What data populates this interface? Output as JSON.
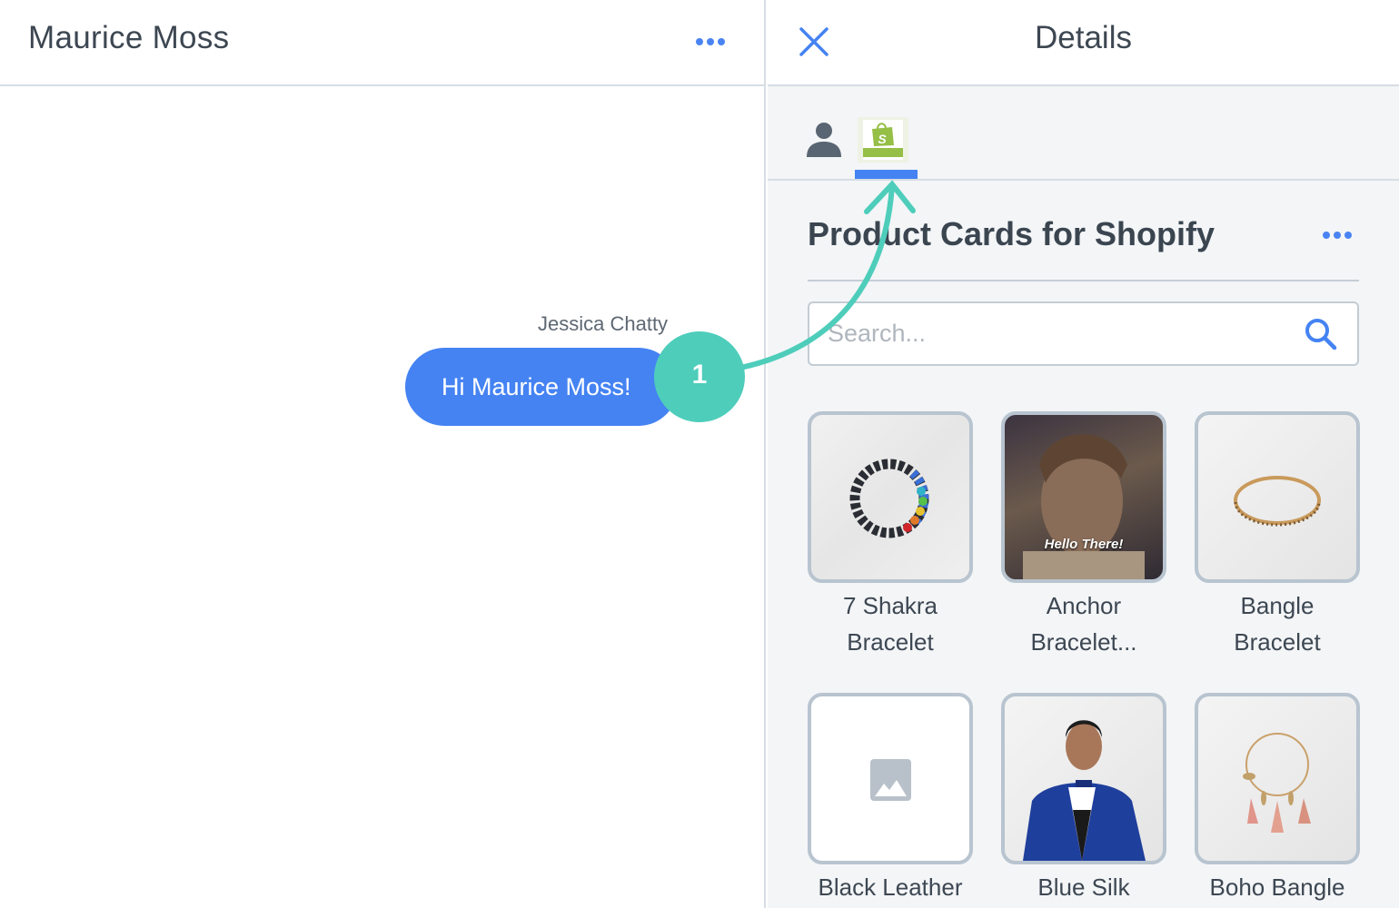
{
  "chat": {
    "title": "Maurice Moss",
    "menu_icon": "more-horizontal-icon",
    "sender": "Jessica Chatty",
    "message": "Hi Maurice Moss!"
  },
  "annotation": {
    "step": "1",
    "color": "#4ecdbb"
  },
  "details": {
    "title": "Details",
    "close_icon": "close-icon",
    "tabs": [
      {
        "name": "contact",
        "icon": "person-icon",
        "active": false
      },
      {
        "name": "shopify",
        "icon": "shopify-bag-icon",
        "active": true
      }
    ],
    "section_title": "Product Cards for Shopify",
    "search": {
      "placeholder": "Search...",
      "value": ""
    },
    "products": [
      {
        "name": "7 Shakra Bracelet",
        "image": "beaded-bracelet"
      },
      {
        "name": "Anchor Bracelet...",
        "image": "gif-hello-there",
        "caption": "Hello There!"
      },
      {
        "name": "Bangle Bracelet",
        "image": "gold-bangle"
      },
      {
        "name": "Black Leather",
        "image": "placeholder-image"
      },
      {
        "name": "Blue Silk",
        "image": "man-blue-tuxedo"
      },
      {
        "name": "Boho Bangle",
        "image": "tassel-bangle"
      }
    ]
  },
  "colors": {
    "accent": "#4583f3",
    "text": "#3d4752",
    "border": "#b8c4cf",
    "panel_bg": "#f3f5f7",
    "shopify_green": "#95bf47"
  }
}
